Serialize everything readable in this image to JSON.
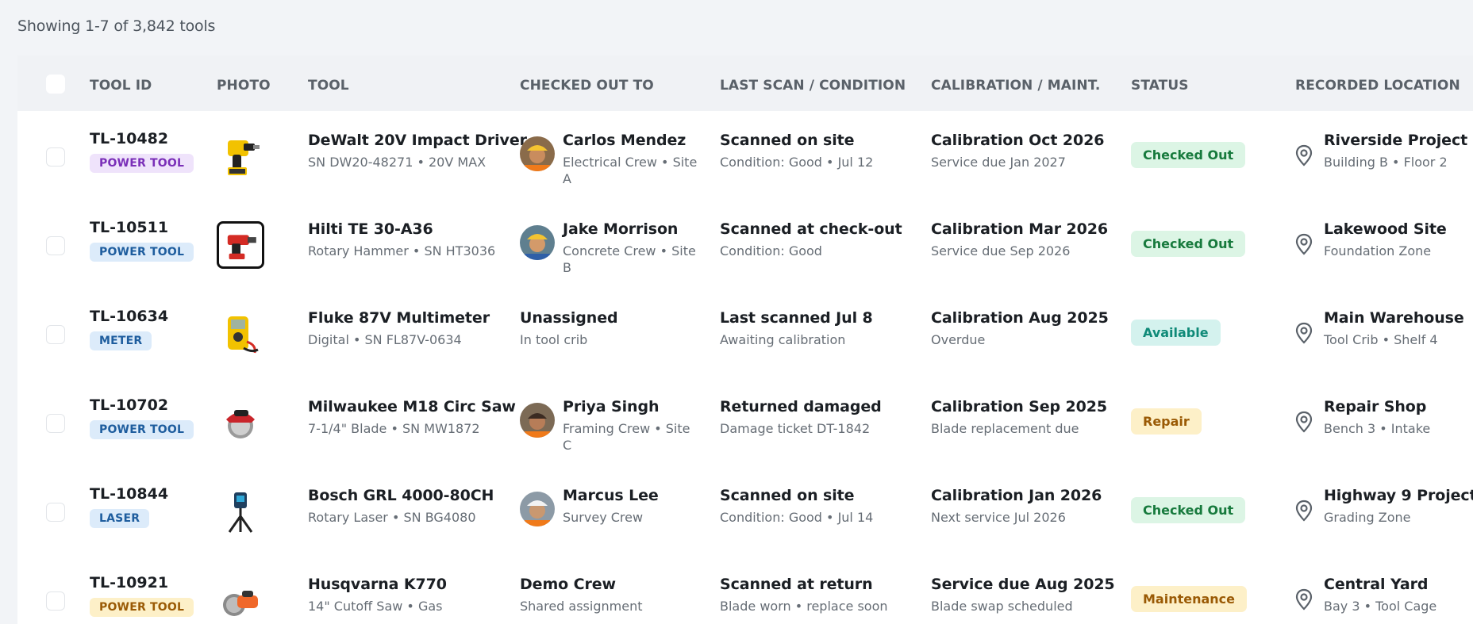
{
  "summary": "Showing 1-7 of 3,842 tools",
  "columns": {
    "tool_id": "TOOL ID",
    "photo": "PHOTO",
    "tool": "TOOL",
    "checked_out_to": "CHECKED OUT TO",
    "last_scan": "LAST SCAN / CONDITION",
    "calibration": "CALIBRATION / MAINT.",
    "status": "STATUS",
    "location": "RECORDED LOCATION"
  },
  "colors": {
    "power_tool_purple": "#7a2fb8",
    "category_blue": "#1e5d9e",
    "checked_out_green": "#177a3d",
    "available_teal": "#0f8a78",
    "repair_amber": "#9a5a05"
  },
  "rows": [
    {
      "id": "TL-10482",
      "category": "POWER TOOL",
      "photo_icon": "impact-driver-icon",
      "tool": "DeWalt 20V Impact Driver",
      "tool_sub": "SN DW20-48271 • 20V MAX",
      "person": "Carlos Mendez",
      "person_sub": "Electrical Crew • Site A",
      "scan": "Scanned on site",
      "scan_sub": "Condition: Good • Jul 12",
      "cal": "Calibration Oct 2026",
      "cal_sub": "Service due Jan 2027",
      "status": "Checked Out",
      "loc": "Riverside Project",
      "loc_sub": "Building B • Floor 2"
    },
    {
      "id": "TL-10511",
      "category": "POWER TOOL",
      "photo_icon": "rotary-hammer-icon",
      "tool": "Hilti TE 30-A36",
      "tool_sub": "Rotary Hammer • SN HT3036",
      "person": "Jake Morrison",
      "person_sub": "Concrete Crew • Site B",
      "scan": "Scanned at check-out",
      "scan_sub": "Condition: Good",
      "cal": "Calibration Mar 2026",
      "cal_sub": "Service due Sep 2026",
      "status": "Checked Out",
      "loc": "Lakewood Site",
      "loc_sub": "Foundation Zone"
    },
    {
      "id": "TL-10634",
      "category": "METER",
      "photo_icon": "multimeter-icon",
      "tool": "Fluke 87V Multimeter",
      "tool_sub": "Digital • SN FL87V-0634",
      "person": "Unassigned",
      "person_sub": "In tool crib",
      "scan": "Last scanned Jul 8",
      "scan_sub": "Awaiting calibration",
      "cal": "Calibration Aug 2025",
      "cal_sub": "Overdue",
      "status": "Available",
      "loc": "Main Warehouse",
      "loc_sub": "Tool Crib • Shelf 4"
    },
    {
      "id": "TL-10702",
      "category": "POWER TOOL",
      "photo_icon": "circular-saw-icon",
      "tool": "Milwaukee M18 Circ Saw",
      "tool_sub": "7-1/4\" Blade • SN MW1872",
      "person": "Priya Singh",
      "person_sub": "Framing Crew • Site C",
      "scan": "Returned damaged",
      "scan_sub": "Damage ticket DT-1842",
      "cal": "Calibration Sep 2025",
      "cal_sub": "Blade replacement due",
      "status": "Repair",
      "loc": "Repair Shop",
      "loc_sub": "Bench 3 • Intake"
    },
    {
      "id": "TL-10844",
      "category": "LASER",
      "photo_icon": "rotary-laser-icon",
      "tool": "Bosch GRL 4000-80CH",
      "tool_sub": "Rotary Laser • SN BG4080",
      "person": "Marcus Lee",
      "person_sub": "Survey Crew",
      "scan": "Scanned on site",
      "scan_sub": "Condition: Good • Jul 14",
      "cal": "Calibration Jan 2026",
      "cal_sub": "Next service Jul 2026",
      "status": "Checked Out",
      "loc": "Highway 9 Project",
      "loc_sub": "Grading Zone"
    },
    {
      "id": "TL-10921",
      "category": "POWER TOOL",
      "photo_icon": "cutoff-saw-icon",
      "tool": "Husqvarna K770",
      "tool_sub": "14\" Cutoff Saw • Gas",
      "person": "Demo Crew",
      "person_sub": "Shared assignment",
      "scan": "Scanned at return",
      "scan_sub": "Blade worn • replace soon",
      "cal": "Service due Aug 2025",
      "cal_sub": "Blade swap scheduled",
      "status": "Maintenance",
      "loc": "Central Yard",
      "loc_sub": "Bay 3 • Tool Cage"
    }
  ]
}
